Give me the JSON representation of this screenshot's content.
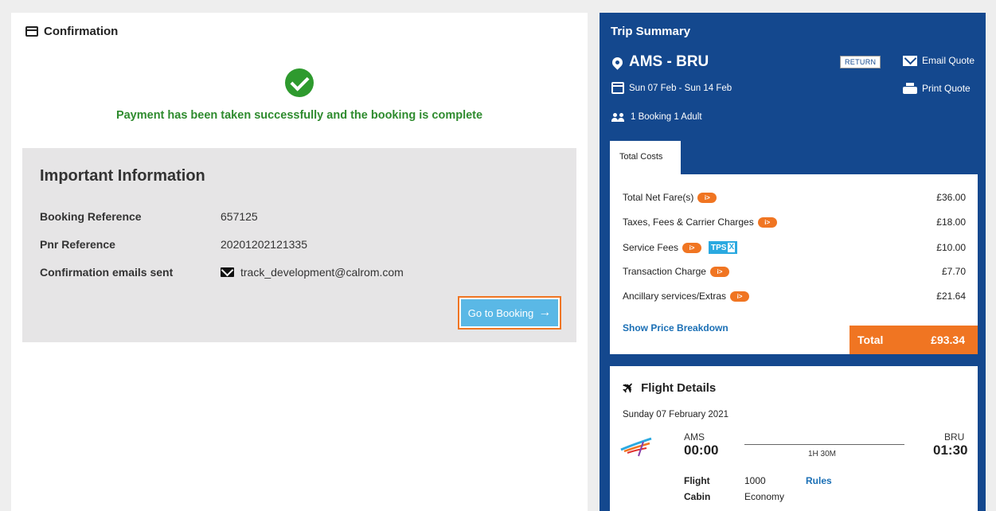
{
  "confirmation": {
    "header": "Confirmation",
    "success_message": "Payment has been taken successfully and the booking is complete",
    "important": {
      "title": "Important Information",
      "rows": [
        {
          "label": "Booking Reference",
          "value": "657125"
        },
        {
          "label": "Pnr Reference",
          "value": "20201202121335"
        },
        {
          "label": "Confirmation emails sent",
          "value": "track_development@calrom.com"
        }
      ],
      "goto_button": "Go to Booking"
    }
  },
  "trip": {
    "title": "Trip Summary",
    "route": "AMS - BRU",
    "trip_type": "RETURN",
    "email_quote": "Email Quote",
    "print_quote": "Print Quote",
    "dates": "Sun 07 Feb - Sun 14 Feb",
    "passengers": "1 Booking 1 Adult",
    "tab": "Total Costs",
    "costs": [
      {
        "label": "Total Net Fare(s)",
        "amount": "£36.00"
      },
      {
        "label": "Taxes, Fees & Carrier Charges",
        "amount": "£18.00"
      },
      {
        "label": "Service Fees",
        "amount": "£10.00",
        "badge": "TPS",
        "badge_x": "X"
      },
      {
        "label": "Transaction Charge",
        "amount": "£7.70"
      },
      {
        "label": "Ancillary services/Extras",
        "amount": "£21.64"
      }
    ],
    "info_pill": "i>",
    "breakdown_link": "Show Price Breakdown",
    "total_label": "Total",
    "total_amount": "£93.34"
  },
  "flight": {
    "title": "Flight Details",
    "date": "Sunday 07 February 2021",
    "origin": "AMS",
    "departure": "00:00",
    "destination": "BRU",
    "arrival": "01:30",
    "duration": "1H 30M",
    "flight_label": "Flight",
    "flight_number": "1000",
    "cabin_label": "Cabin",
    "cabin": "Economy",
    "rules_link": "Rules"
  },
  "colors": {
    "primary": "#14488e",
    "accent": "#f07522",
    "success": "#2e8b2e",
    "button": "#5ab8e6"
  }
}
